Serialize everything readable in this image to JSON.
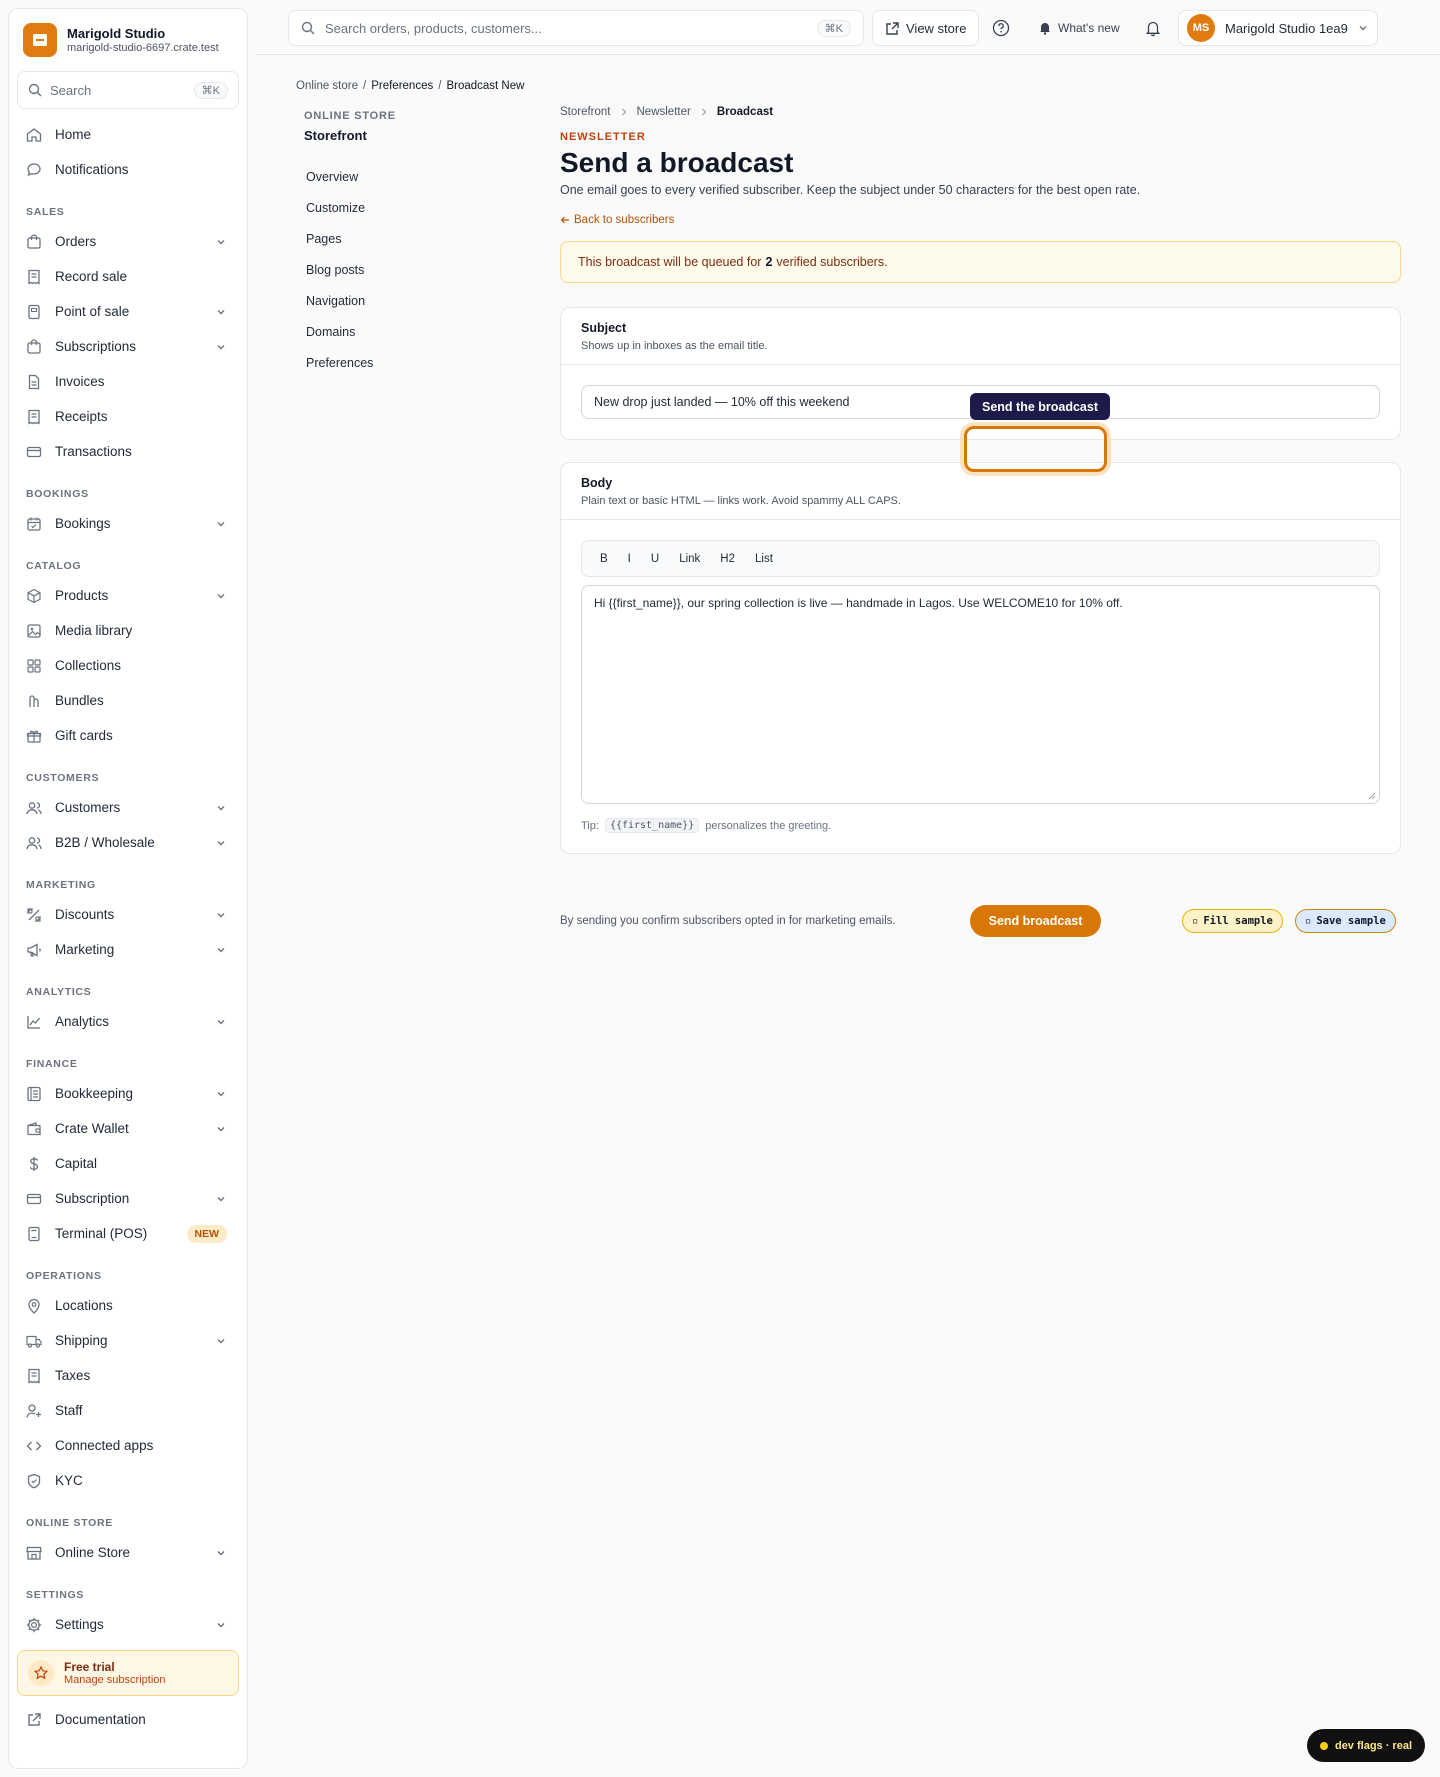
{
  "brand": {
    "name": "Marigold Studio",
    "domain": "marigold-studio-6697.crate.test"
  },
  "sidebar": {
    "search_label": "Search",
    "search_kbd": "⌘K",
    "top_items": [
      {
        "label": "Home",
        "icon": "home-icon"
      },
      {
        "label": "Notifications",
        "icon": "chat-bubble-icon"
      }
    ],
    "sections": [
      {
        "title": "SALES",
        "items": [
          {
            "label": "Orders",
            "icon": "bag-icon",
            "chevron": true
          },
          {
            "label": "Record sale",
            "icon": "receipt-icon",
            "chevron": false
          },
          {
            "label": "Point of sale",
            "icon": "pos-icon",
            "chevron": true
          },
          {
            "label": "Subscriptions",
            "icon": "bag-icon",
            "chevron": true
          },
          {
            "label": "Invoices",
            "icon": "document-icon",
            "chevron": false
          },
          {
            "label": "Receipts",
            "icon": "receipt-icon",
            "chevron": false
          },
          {
            "label": "Transactions",
            "icon": "card-icon",
            "chevron": false
          }
        ]
      },
      {
        "title": "BOOKINGS",
        "items": [
          {
            "label": "Bookings",
            "icon": "calendar-icon",
            "chevron": true
          }
        ]
      },
      {
        "title": "CATALOG",
        "items": [
          {
            "label": "Products",
            "icon": "cube-icon",
            "chevron": true
          },
          {
            "label": "Media library",
            "icon": "image-icon",
            "chevron": false
          },
          {
            "label": "Collections",
            "icon": "grid-icon",
            "chevron": false
          },
          {
            "label": "Bundles",
            "icon": "bundle-icon",
            "chevron": false
          },
          {
            "label": "Gift cards",
            "icon": "gift-icon",
            "chevron": false
          }
        ]
      },
      {
        "title": "CUSTOMERS",
        "items": [
          {
            "label": "Customers",
            "icon": "users-icon",
            "chevron": true
          },
          {
            "label": "B2B / Wholesale",
            "icon": "users-icon",
            "chevron": true
          }
        ]
      },
      {
        "title": "MARKETING",
        "items": [
          {
            "label": "Discounts",
            "icon": "discount-icon",
            "chevron": true
          },
          {
            "label": "Marketing",
            "icon": "megaphone-icon",
            "chevron": true
          }
        ]
      },
      {
        "title": "ANALYTICS",
        "items": [
          {
            "label": "Analytics",
            "icon": "chart-icon",
            "chevron": true
          }
        ]
      },
      {
        "title": "FINANCE",
        "items": [
          {
            "label": "Bookkeeping",
            "icon": "ledger-icon",
            "chevron": true
          },
          {
            "label": "Crate Wallet",
            "icon": "wallet-icon",
            "chevron": true
          },
          {
            "label": "Capital",
            "icon": "dollar-icon",
            "chevron": false
          },
          {
            "label": "Subscription",
            "icon": "card-icon",
            "chevron": true
          },
          {
            "label": "Terminal (POS)",
            "icon": "terminal-icon",
            "chevron": false,
            "badge": "NEW"
          }
        ]
      },
      {
        "title": "OPERATIONS",
        "items": [
          {
            "label": "Locations",
            "icon": "pin-icon",
            "chevron": false
          },
          {
            "label": "Shipping",
            "icon": "truck-icon",
            "chevron": true
          },
          {
            "label": "Taxes",
            "icon": "receipt-icon",
            "chevron": false
          },
          {
            "label": "Staff",
            "icon": "user-plus-icon",
            "chevron": false
          },
          {
            "label": "Connected apps",
            "icon": "code-icon",
            "chevron": false
          },
          {
            "label": "KYC",
            "icon": "shield-icon",
            "chevron": false
          }
        ]
      },
      {
        "title": "ONLINE STORE",
        "items": [
          {
            "label": "Online Store",
            "icon": "store-icon",
            "chevron": true
          }
        ]
      },
      {
        "title": "SETTINGS",
        "items": [
          {
            "label": "Settings",
            "icon": "gear-icon",
            "chevron": true
          }
        ]
      }
    ],
    "trial": {
      "title": "Free trial",
      "subtitle": "Manage subscription"
    },
    "documentation": "Documentation"
  },
  "topbar": {
    "search_placeholder": "Search orders, products, customers...",
    "search_kbd": "⌘K",
    "view_store": "View store",
    "whats_new": "What's new",
    "avatar_initials": "MS",
    "account_name": "Marigold Studio 1ea9"
  },
  "breadcrumb_top": [
    "Online store",
    "Preferences",
    "Broadcast New"
  ],
  "subnav": {
    "section": "ONLINE STORE",
    "title": "Storefront",
    "items": [
      "Overview",
      "Customize",
      "Pages",
      "Blog posts",
      "Navigation",
      "Domains",
      "Preferences"
    ]
  },
  "main": {
    "breadcrumb": [
      "Storefront",
      "Newsletter",
      "Broadcast"
    ],
    "eyebrow": "NEWSLETTER",
    "title": "Send a broadcast",
    "lead": "One email goes to every verified subscriber. Keep the subject under 50 characters for the best open rate.",
    "back_link": "Back to subscribers",
    "alert": {
      "prefix": "This broadcast will be queued for",
      "count": "2",
      "suffix": "verified subscribers."
    },
    "subject": {
      "title": "Subject",
      "help": "Shows up in inboxes as the email title.",
      "value": "New drop just landed — 10% off this weekend"
    },
    "body": {
      "title": "Body",
      "help": "Plain text or basic HTML — links work. Avoid spammy ALL CAPS.",
      "toolbar": [
        "B",
        "I",
        "U",
        "Link",
        "H2",
        "List"
      ],
      "value": "Hi {{first_name}}, our spring collection is live — handmade in Lagos. Use WELCOME10 for 10% off.",
      "tip_prefix": "Tip:",
      "tip_code": "{{first_name}}",
      "tip_suffix": "personalizes the greeting."
    },
    "confirm_text": "By sending you confirm subscribers opted in for marketing emails.",
    "send_button": "Send broadcast",
    "fill_sample": "Fill sample",
    "save_sample": "Save sample",
    "tooltip": "Send the broadcast"
  },
  "dev_pill": "dev flags · real",
  "colors": {
    "accent": "#d97706",
    "brand": "#e07b10",
    "tooltip_bg": "#1e1b4b",
    "alert_bg": "#fffbeb"
  }
}
